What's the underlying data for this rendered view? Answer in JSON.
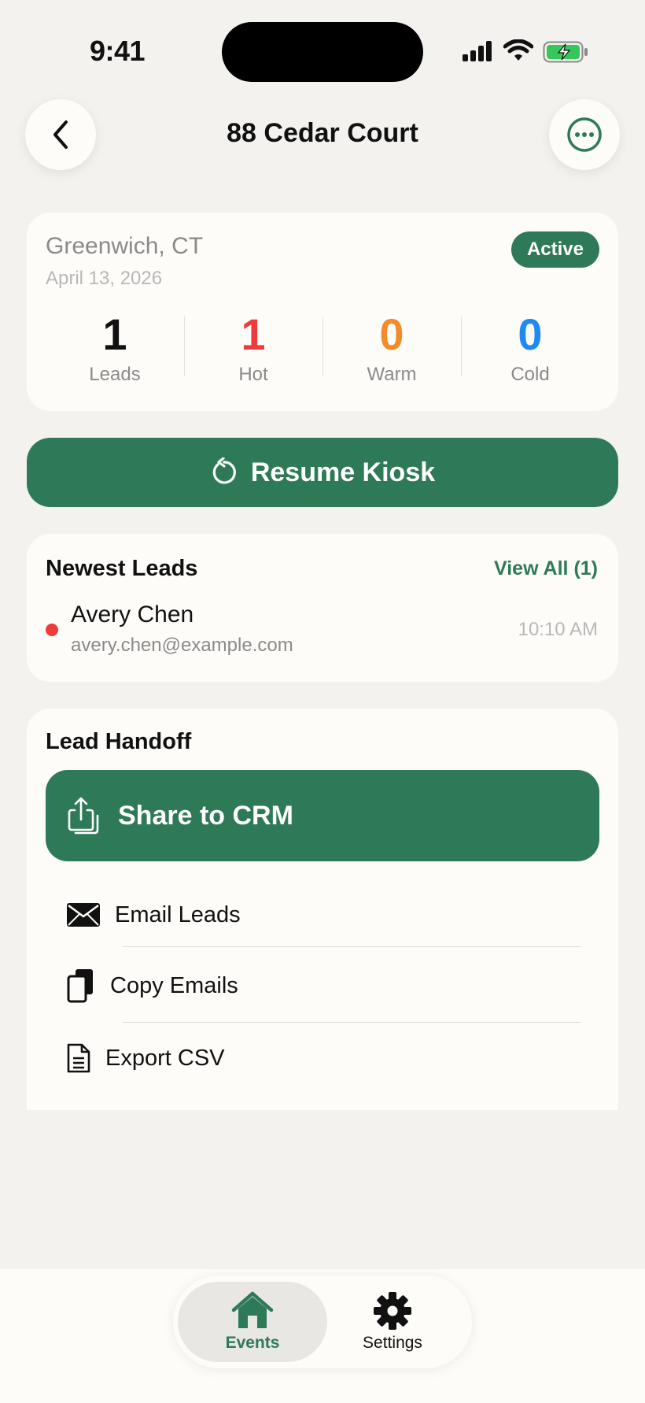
{
  "status_bar": {
    "time": "9:41"
  },
  "nav": {
    "title": "88 Cedar Court"
  },
  "event": {
    "location": "Greenwich, CT",
    "date": "April 13, 2026",
    "status": "Active",
    "stats": [
      {
        "value": "1",
        "label": "Leads",
        "color": "#111111"
      },
      {
        "value": "1",
        "label": "Hot",
        "color": "#ef3b3b"
      },
      {
        "value": "0",
        "label": "Warm",
        "color": "#f18b2b"
      },
      {
        "value": "0",
        "label": "Cold",
        "color": "#1f8af2"
      }
    ]
  },
  "resume_button": {
    "label": "Resume Kiosk"
  },
  "newest_leads": {
    "title": "Newest Leads",
    "view_all": "View All (1)",
    "leads": [
      {
        "name": "Avery Chen",
        "email": "avery.chen@example.com",
        "time": "10:10 AM",
        "temperature_color": "#ef3b3b"
      }
    ]
  },
  "lead_handoff": {
    "title": "Lead Handoff",
    "share_label": "Share to CRM",
    "actions": [
      {
        "label": "Email Leads",
        "icon": "envelope-icon"
      },
      {
        "label": "Copy Emails",
        "icon": "copy-icon"
      },
      {
        "label": "Export CSV",
        "icon": "document-icon"
      }
    ]
  },
  "tabs": [
    {
      "label": "Events",
      "icon": "house-icon",
      "selected": true
    },
    {
      "label": "Settings",
      "icon": "gear-icon",
      "selected": false
    }
  ],
  "colors": {
    "accent": "#2e7a57",
    "background": "#f3f2ee",
    "card": "#fdfcf8"
  }
}
